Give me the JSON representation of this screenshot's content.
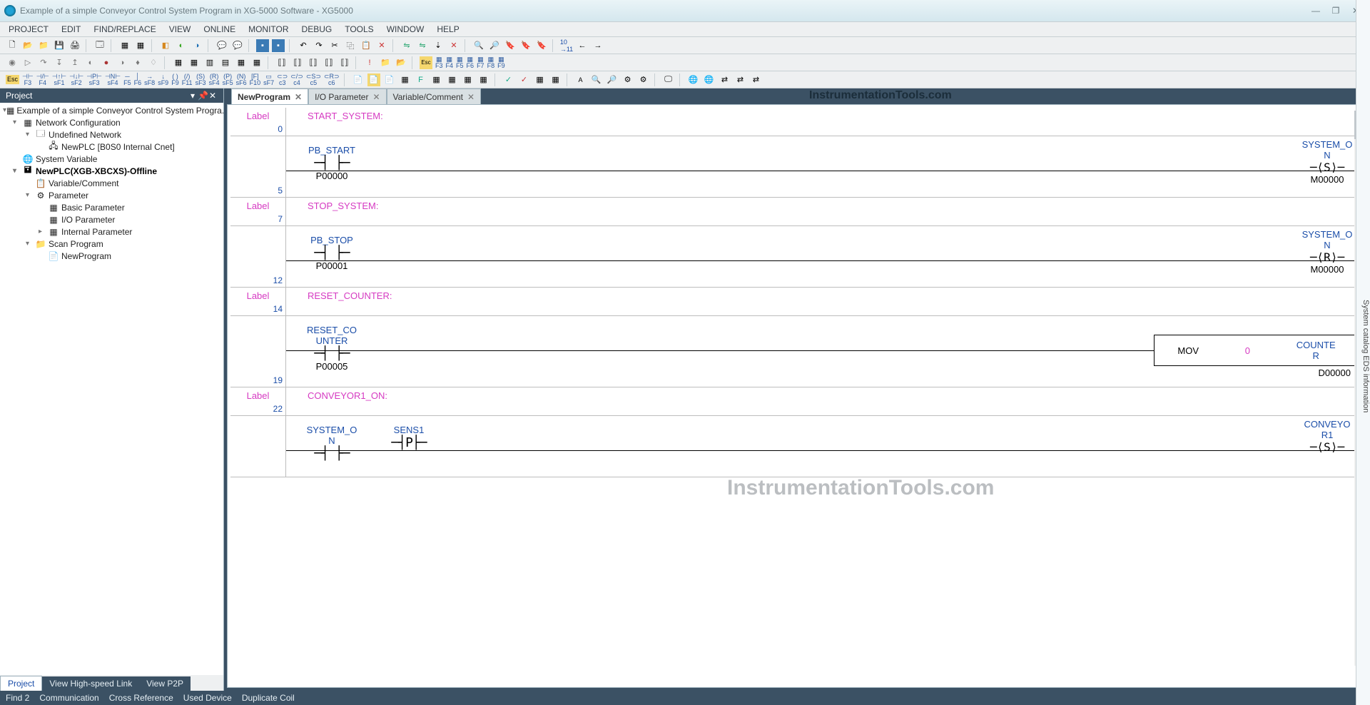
{
  "window": {
    "title": "Example of a simple Conveyor Control System Program in XG-5000 Software - XG5000"
  },
  "menu": [
    "PROJECT",
    "EDIT",
    "FIND/REPLACE",
    "VIEW",
    "ONLINE",
    "MONITOR",
    "DEBUG",
    "TOOLS",
    "WINDOW",
    "HELP"
  ],
  "toolbar_labels_row3": [
    "Esc",
    "F3",
    "F4",
    "F5",
    "F6",
    "F7",
    "F8",
    "F9",
    "F10",
    "F11",
    "sF1",
    "sF2",
    "sF3",
    "sF4",
    "sF5",
    "sF6",
    "F3",
    "F4",
    "F5",
    "F6",
    "F7",
    "F8",
    "F9"
  ],
  "side_rail": "System catalog   EDS information",
  "panel": {
    "title": "Project",
    "tabs": [
      "Project",
      "View High-speed Link",
      "View P2P"
    ]
  },
  "tree": {
    "root": "Example of a simple Conveyor Control System Progra...",
    "netcfg": "Network Configuration",
    "undef": "Undefined Network",
    "newplc_b0s0": "NewPLC [B0S0 Internal Cnet]",
    "sysvar": "System Variable",
    "newplc": "NewPLC(XGB-XBCXS)-Offline",
    "varcom": "Variable/Comment",
    "param": "Parameter",
    "bparam": "Basic Parameter",
    "ioparam": "I/O Parameter",
    "intparam": "Internal Parameter",
    "scan": "Scan Program",
    "newprog": "NewProgram"
  },
  "doc_tabs": [
    {
      "label": "NewProgram",
      "active": true
    },
    {
      "label": "I/O Parameter",
      "active": false
    },
    {
      "label": "Variable/Comment",
      "active": false
    }
  ],
  "ladder": {
    "label_word": "Label",
    "rows": [
      {
        "type": "label",
        "num": "0",
        "text": "START_SYSTEM:"
      },
      {
        "type": "rung",
        "num": "5",
        "contact": {
          "name": "PB_START",
          "sym": "─┤ ├─",
          "addr": "P00000"
        },
        "coil": {
          "name": "SYSTEM_O\nN",
          "sym": "⟨S⟩",
          "addr": "M00000"
        }
      },
      {
        "type": "label",
        "num": "7",
        "text": "STOP_SYSTEM:"
      },
      {
        "type": "rung",
        "num": "12",
        "contact": {
          "name": "PB_STOP",
          "sym": "─┤ ├─",
          "addr": "P00001"
        },
        "coil": {
          "name": "SYSTEM_O\nN",
          "sym": "⟨R⟩",
          "addr": "M00000"
        }
      },
      {
        "type": "label",
        "num": "14",
        "text": "RESET_COUNTER:"
      },
      {
        "type": "rung_block",
        "num": "19",
        "contact": {
          "name": "RESET_CO\nUNTER",
          "sym": "─┤ ├─",
          "addr": "P00005"
        },
        "block": {
          "op": "MOV",
          "p1": "0",
          "p2": "COUNTE\nR",
          "addr": "D00000"
        }
      },
      {
        "type": "label",
        "num": "22",
        "text": "CONVEYOR1_ON:"
      },
      {
        "type": "rung2",
        "num": "",
        "contact1": {
          "name": "SYSTEM_O\nN",
          "sym": "─┤ ├─"
        },
        "contact2": {
          "name": "SENS1",
          "sym": "─┤P├─"
        },
        "coil": {
          "name": "CONVEYO\nR1",
          "sym": "⟨S⟩"
        }
      }
    ]
  },
  "status": [
    "Find 2",
    "Communication",
    "Cross Reference",
    "Used Device",
    "Duplicate Coil"
  ],
  "watermark": "InstrumentationTools.com"
}
